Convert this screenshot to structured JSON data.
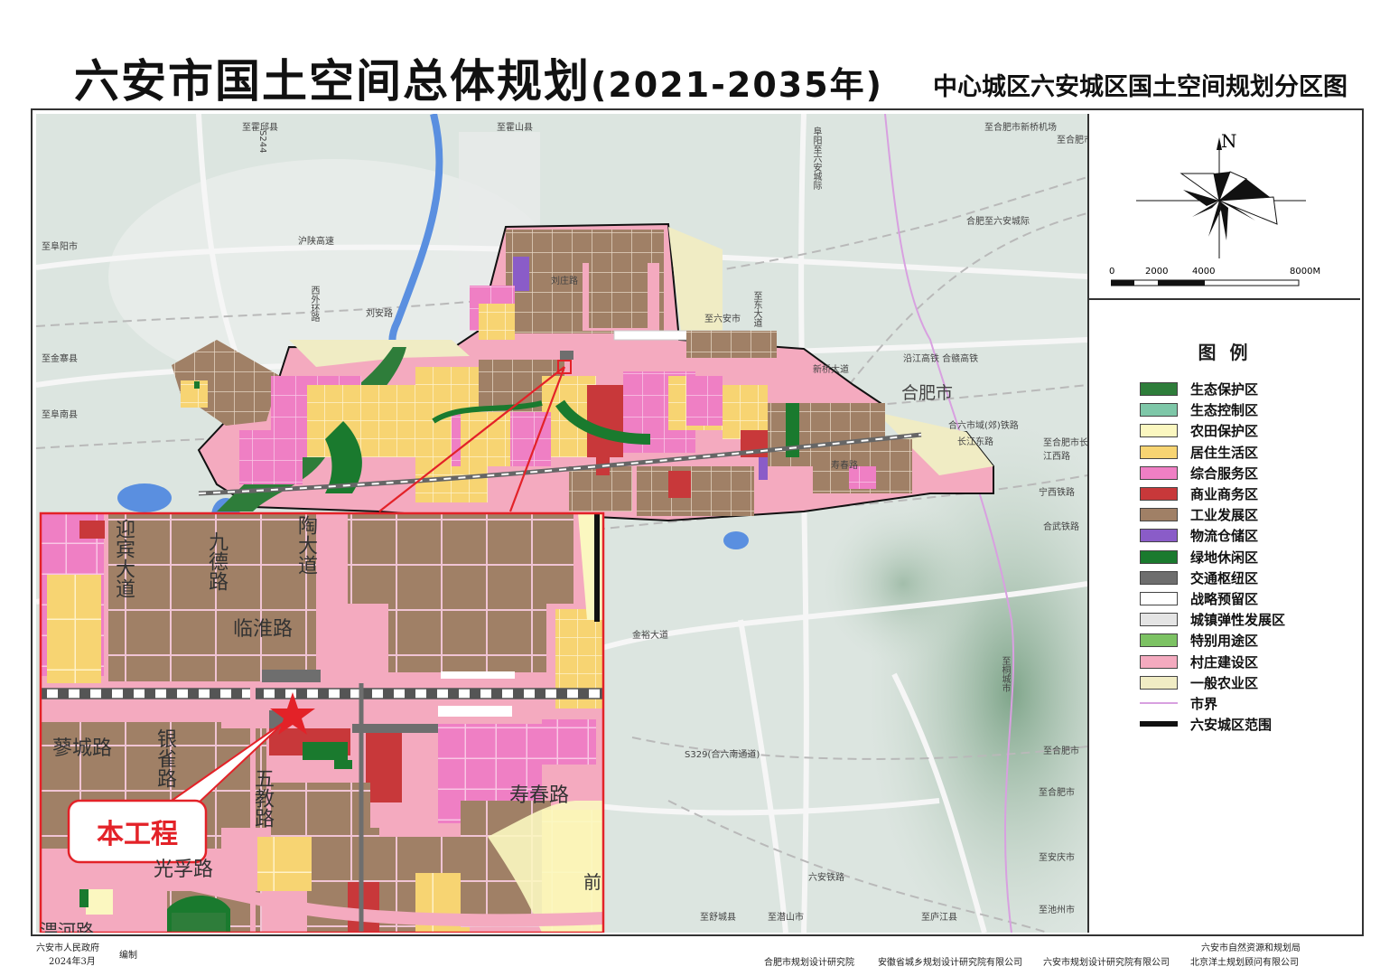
{
  "header": {
    "title_main": "六安市国土空间总体规划",
    "title_years": "(2021-2035年)",
    "subtitle": "中心城区六安城区国土空间规划分区图"
  },
  "compass": {
    "north_label": "N"
  },
  "scale_bar": {
    "ticks": [
      "0",
      "2000",
      "4000",
      "8000M"
    ]
  },
  "legend": {
    "title": "图 例",
    "items": [
      {
        "label": "生态保护区",
        "color": "#2e7d3a",
        "style": "fill"
      },
      {
        "label": "生态控制区",
        "color": "#7ec7a8",
        "style": "fill"
      },
      {
        "label": "农田保护区",
        "color": "#fbf7c0",
        "style": "fill"
      },
      {
        "label": "居住生活区",
        "color": "#f7d472",
        "style": "fill"
      },
      {
        "label": "综合服务区",
        "color": "#ef7fc4",
        "style": "fill"
      },
      {
        "label": "商业商务区",
        "color": "#c8383a",
        "style": "fill"
      },
      {
        "label": "工业发展区",
        "color": "#a08066",
        "style": "fill"
      },
      {
        "label": "物流仓储区",
        "color": "#8a5cc8",
        "style": "fill"
      },
      {
        "label": "绿地休闲区",
        "color": "#1a7a2e",
        "style": "fill"
      },
      {
        "label": "交通枢纽区",
        "color": "#6e6e6e",
        "style": "fill"
      },
      {
        "label": "战略预留区",
        "color": "#ffffff",
        "style": "fill"
      },
      {
        "label": "城镇弹性发展区",
        "color": "#e4e4e4",
        "style": "fill"
      },
      {
        "label": "特别用途区",
        "color": "#7cc263",
        "style": "fill"
      },
      {
        "label": "村庄建设区",
        "color": "#f4aabf",
        "style": "fill"
      },
      {
        "label": "一般农业区",
        "color": "#f0ecc4",
        "style": "fill"
      },
      {
        "label": "市界",
        "color": "#d8a0e0",
        "style": "line"
      },
      {
        "label": "六安城区范围",
        "color": "#111111",
        "style": "thickline"
      }
    ]
  },
  "map_labels": {
    "hefei_city": "合肥市",
    "roads": [
      "至霍邱县",
      "S244",
      "沪陕高速",
      "至阜阳市",
      "刘安路",
      "至霍山县",
      "至合肥市新桥机场",
      "至合肥市",
      "沿江高铁 合赣高铁",
      "合六市域(郊)铁路",
      "长江东路",
      "至合肥市长江西路",
      "宁西铁路",
      "合武铁路",
      "金裕大道",
      "S329(合六南通道)",
      "至合肥市",
      "六安铁路",
      "至舒城县",
      "至金寨县",
      "至庐江县",
      "至池州市",
      "至潜山市",
      "至安庆市",
      "至合肥市",
      "阜阳至六安城际",
      "合肥至六安城际",
      "至桐城市",
      "新桥大道",
      "刘庄路",
      "西外环路",
      "至东大道",
      "至阜南县",
      "至六安市",
      "寿春路"
    ]
  },
  "inset": {
    "labels": [
      "迎宾大道",
      "九德路",
      "陶大道",
      "临淮路",
      "蓼城路",
      "银雀路",
      "五教路",
      "寿春路",
      "光孚路",
      "淠河路",
      "前"
    ],
    "project_label": "本工程"
  },
  "footer": {
    "left_org": "六安市人民政府",
    "left_date": "2024年3月",
    "left_action": "编制",
    "right_top": "六安市自然资源和规划局",
    "orgs": [
      "合肥市规划设计研究院",
      "安徽省城乡规划设计研究院有限公司",
      "六安市规划设计研究院有限公司",
      "北京洋土规划顾问有限公司"
    ]
  }
}
